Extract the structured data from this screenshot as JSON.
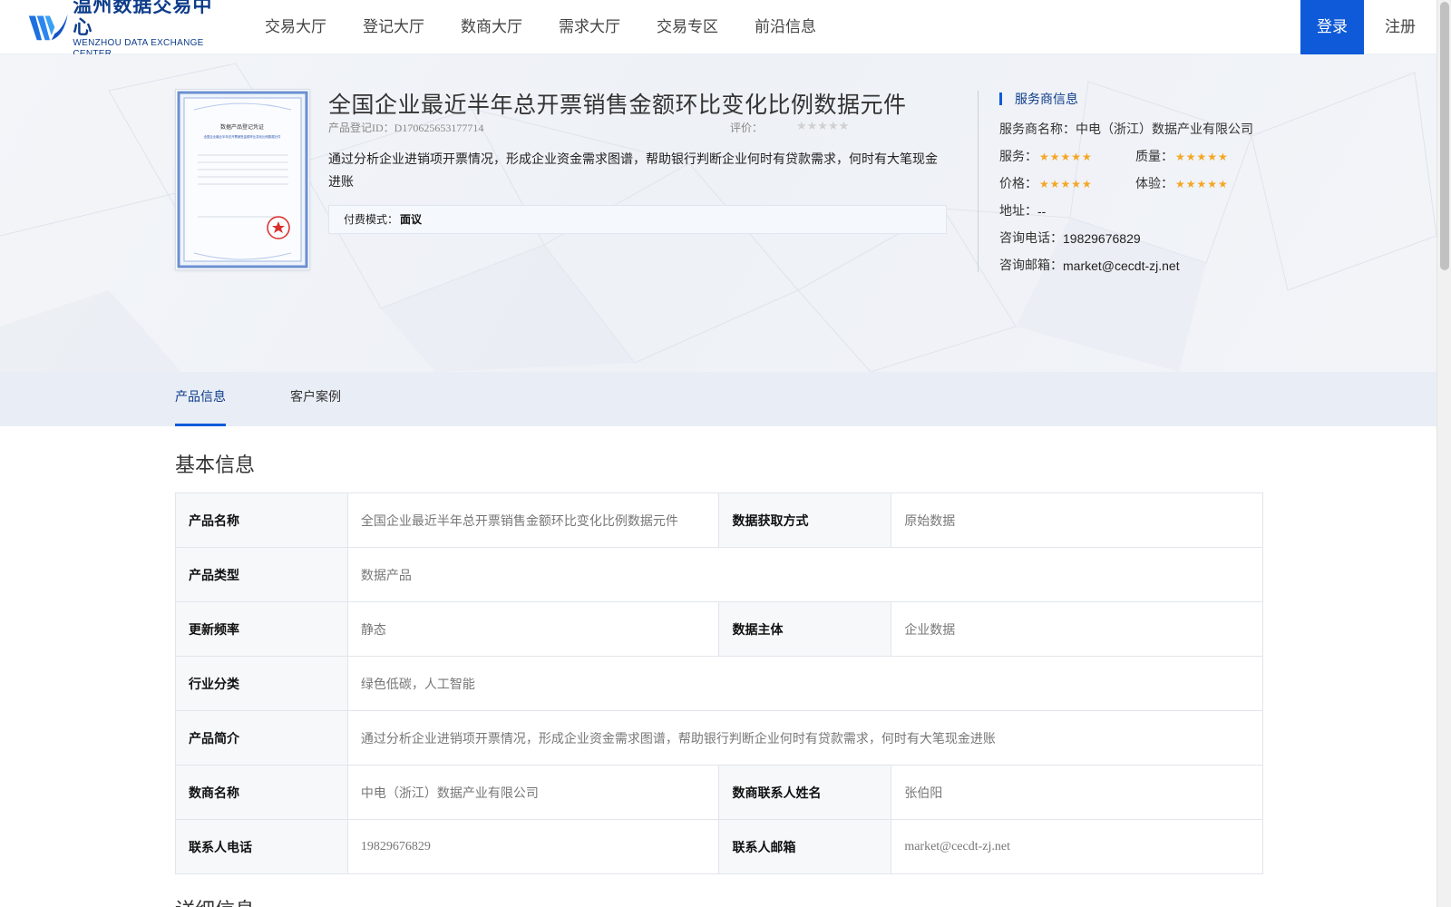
{
  "header": {
    "logo_cn": "温州数据交易中心",
    "logo_en": "WENZHOU DATA EXCHANGE CENTER",
    "nav": [
      "交易大厅",
      "登记大厅",
      "数商大厅",
      "需求大厅",
      "交易专区",
      "前沿信息"
    ],
    "login": "登录",
    "register": "注册",
    "accent": "#0f5ad8"
  },
  "product": {
    "title": "全国企业最近半年总开票销售金额环比变化比例数据元件",
    "reg_id": "产品登记ID：D170625653177714",
    "rating_label": "评价：",
    "rating_stars": "★★★★★",
    "rating_value": 0,
    "description": "通过分析企业进销项开票情况，形成企业资金需求图谱，帮助银行判断企业何时有贷款需求，何时有大笔现金进账",
    "pay_label": "付费模式：",
    "pay_value": "面议"
  },
  "certificate": {
    "title": "数据产品登记凭证",
    "subtitle": "全国企业最近半年总开票销售金额环比变化比例数据元件"
  },
  "provider": {
    "heading": "服务商信息",
    "name_label": "服务商名称：",
    "name": "中电（浙江）数据产业有限公司",
    "service_label": "服务：",
    "quality_label": "质量：",
    "price_label": "价格：",
    "experience_label": "体验：",
    "stars": "★★★★★",
    "service_rating": 5,
    "quality_rating": 5,
    "price_rating": 5,
    "experience_rating": 5,
    "address_label": "地址：",
    "address": "--",
    "phone_label": "咨询电话：",
    "phone": "19829676829",
    "email_label": "咨询邮箱：",
    "email": "market@cecdt-zj.net",
    "star_color": "#f5a623"
  },
  "tabs": [
    "产品信息",
    "客户案例"
  ],
  "basic_info": {
    "title": "基本信息",
    "rows": [
      [
        {
          "k": "产品名称",
          "v": "全国企业最近半年总开票销售金额环比变化比例数据元件"
        },
        {
          "k": "数据获取方式",
          "v": "原始数据"
        }
      ],
      [
        {
          "k": "产品类型",
          "v": "数据产品"
        }
      ],
      [
        {
          "k": "更新频率",
          "v": "静态"
        },
        {
          "k": "数据主体",
          "v": "企业数据"
        }
      ],
      [
        {
          "k": "行业分类",
          "v": "绿色低碳，人工智能"
        }
      ],
      [
        {
          "k": "产品简介",
          "v": "通过分析企业进销项开票情况，形成企业资金需求图谱，帮助银行判断企业何时有贷款需求，何时有大笔现金进账"
        }
      ],
      [
        {
          "k": "数商名称",
          "v": "中电（浙江）数据产业有限公司"
        },
        {
          "k": "数商联系人姓名",
          "v": "张伯阳"
        }
      ],
      [
        {
          "k": "联系人电话",
          "v": "19829676829"
        },
        {
          "k": "联系人邮箱",
          "v": "market@cecdt-zj.net"
        }
      ]
    ]
  },
  "detail_info": {
    "title": "详细信息"
  }
}
